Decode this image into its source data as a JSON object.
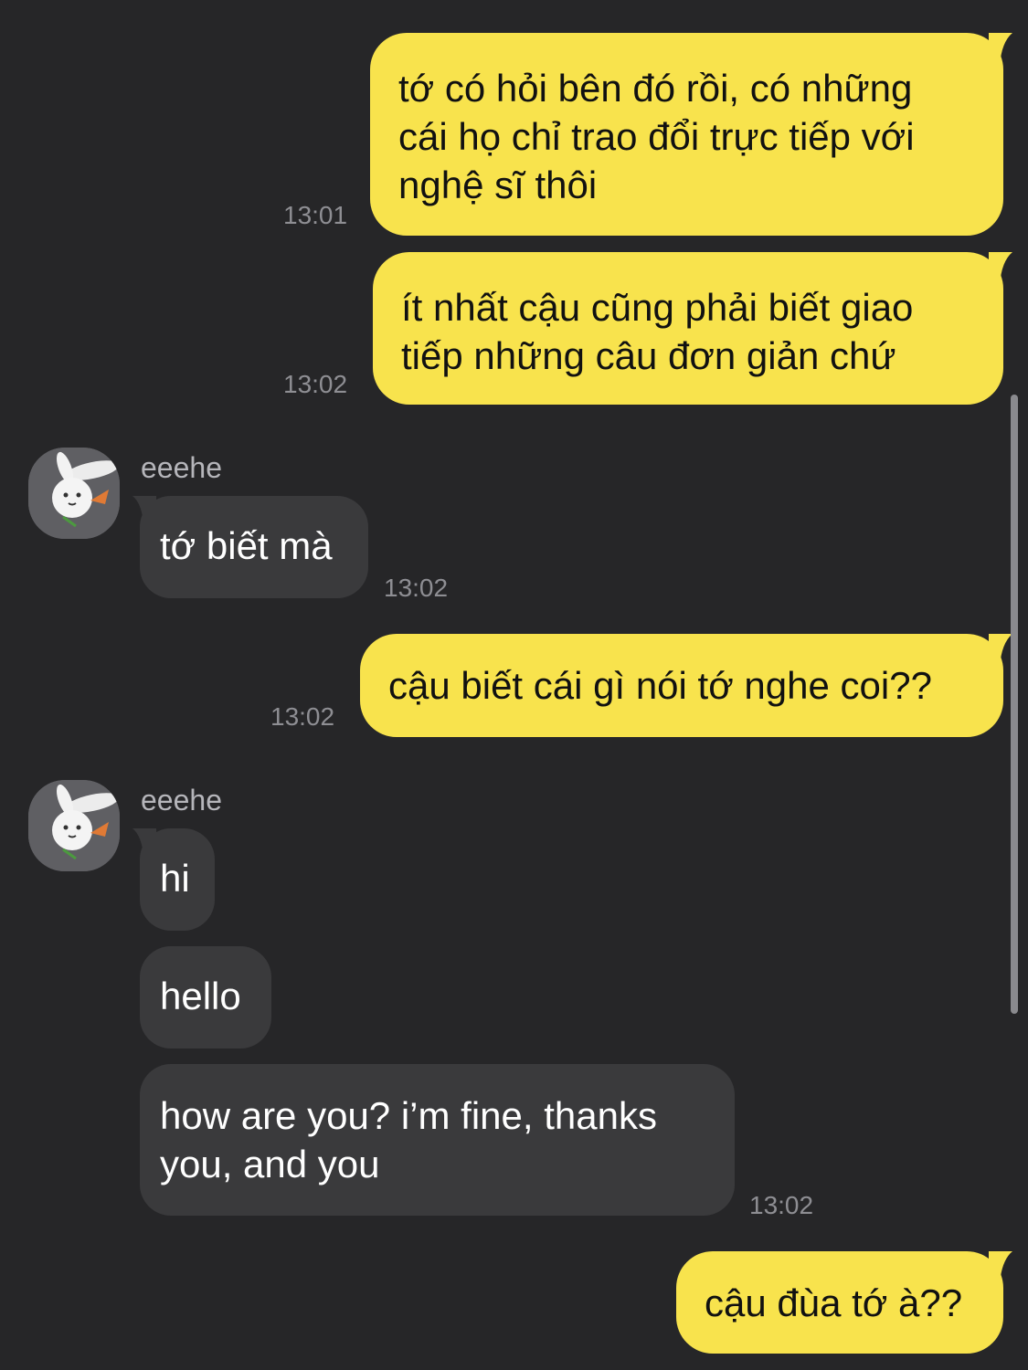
{
  "chat": {
    "messages": [
      {
        "direction": "outgoing",
        "text": "tớ có hỏi bên đó rồi, có những\ncái họ chỉ trao đổi trực tiếp với\nnghệ sĩ thôi",
        "time": "13:01"
      },
      {
        "direction": "outgoing",
        "text": "ít nhất cậu cũng phải biết giao\ntiếp những câu đơn giản chứ",
        "time": "13:02"
      },
      {
        "direction": "incoming",
        "sender": "eeehe",
        "avatar_icon": "white-rabbit-avatar",
        "text": "tớ biết mà",
        "time": "13:02"
      },
      {
        "direction": "outgoing",
        "text": "cậu biết cái gì nói tớ nghe coi??",
        "time": "13:02"
      },
      {
        "direction": "incoming",
        "sender": "eeehe",
        "avatar_icon": "white-rabbit-avatar",
        "text": "hi"
      },
      {
        "direction": "incoming",
        "text": "hello"
      },
      {
        "direction": "incoming",
        "text": "how are you? i’m fine, thanks\nyou, and you",
        "time": "13:02"
      },
      {
        "direction": "outgoing",
        "text": "cậu đùa tớ à??"
      }
    ]
  },
  "colors": {
    "background": "#262628",
    "outgoing_bubble": "#f8e34d",
    "incoming_bubble": "#3a3a3c",
    "timestamp": "#8e8e93"
  }
}
